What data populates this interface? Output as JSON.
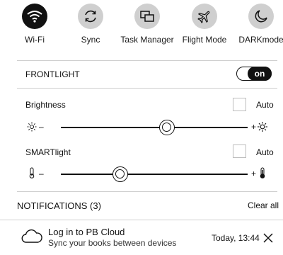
{
  "quick_toggles": [
    {
      "label": "Wi-Fi",
      "icon": "wifi-icon",
      "active": true
    },
    {
      "label": "Sync",
      "icon": "sync-icon",
      "active": false
    },
    {
      "label": "Task Manager",
      "icon": "task-manager-icon",
      "active": false
    },
    {
      "label": "Flight Mode",
      "icon": "airplane-icon",
      "active": false
    },
    {
      "label": "DARKmode",
      "icon": "moon-icon",
      "active": false
    }
  ],
  "frontlight": {
    "label": "FRONTLIGHT",
    "switch_text": "on",
    "enabled": true
  },
  "brightness": {
    "label": "Brightness",
    "auto_label": "Auto",
    "auto_checked": false,
    "level": 0.57,
    "minus": "–",
    "plus": "+"
  },
  "smartlight": {
    "label": "SMARTlight",
    "auto_label": "Auto",
    "auto_checked": false,
    "level": 0.32,
    "minus": "–",
    "plus": "+"
  },
  "notifications": {
    "header": "NOTIFICATIONS (3)",
    "clear_label": "Clear all",
    "items": [
      {
        "title": "Log in to PB Cloud",
        "subtitle": "Sync your books between devices",
        "time": "Today, 13:44",
        "icon": "cloud-icon"
      }
    ]
  },
  "colors": {
    "active": "#111111",
    "inactive": "#cfcfcf",
    "divider": "#cfcfcf"
  }
}
